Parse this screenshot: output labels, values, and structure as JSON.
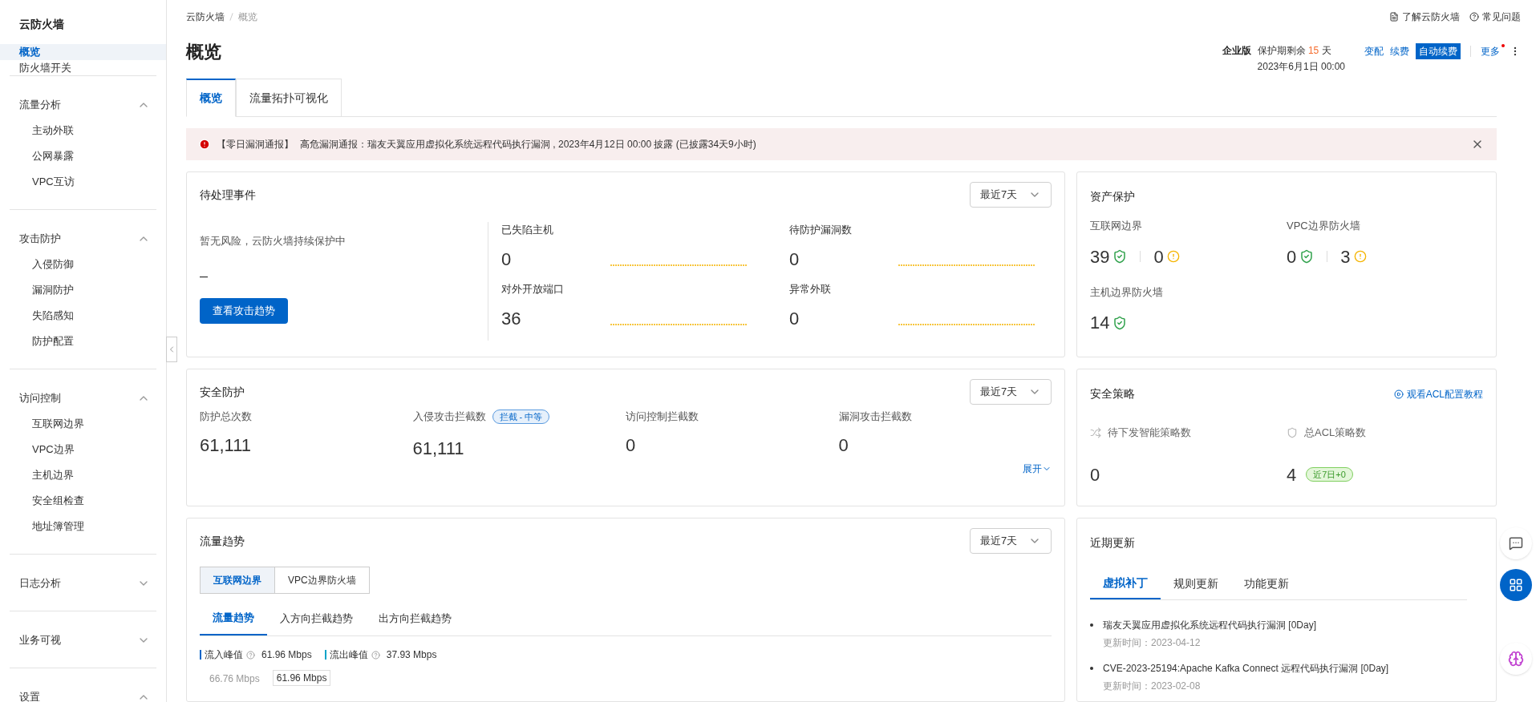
{
  "sidebar": {
    "title": "云防火墙",
    "top_items": [
      {
        "label": "概览",
        "selected": true
      },
      {
        "label": "防火墙开关",
        "selected": false
      }
    ],
    "groups": [
      {
        "label": "流量分析",
        "expanded": true,
        "children": [
          {
            "label": "主动外联"
          },
          {
            "label": "公网暴露"
          },
          {
            "label": "VPC互访"
          }
        ]
      },
      {
        "label": "攻击防护",
        "expanded": true,
        "children": [
          {
            "label": "入侵防御"
          },
          {
            "label": "漏洞防护"
          },
          {
            "label": "失陷感知"
          },
          {
            "label": "防护配置"
          }
        ]
      },
      {
        "label": "访问控制",
        "expanded": true,
        "children": [
          {
            "label": "互联网边界"
          },
          {
            "label": "VPC边界"
          },
          {
            "label": "主机边界"
          },
          {
            "label": "安全组检查"
          },
          {
            "label": "地址簿管理"
          }
        ]
      },
      {
        "label": "日志分析",
        "expanded": false
      },
      {
        "label": "业务可视",
        "expanded": false
      },
      {
        "label": "设置",
        "expanded": true
      }
    ]
  },
  "breadcrumb": [
    "云防火墙",
    "概览"
  ],
  "help_links": [
    {
      "label": "了解云防火墙",
      "kind": "doc"
    },
    {
      "label": "常见问题",
      "kind": "help"
    }
  ],
  "title": "概览",
  "subscription": {
    "edition": "企业版",
    "remaining_prefix": "保护期剩余",
    "days": "15",
    "days_suffix": "天",
    "expiry": "2023年6月1日 00:00",
    "actions": [
      {
        "label": "变配",
        "kind": "link"
      },
      {
        "label": "续费",
        "kind": "link"
      },
      {
        "label": "自动续费",
        "kind": "primary"
      }
    ],
    "more": {
      "label": "更多",
      "badge": true
    }
  },
  "tabs": [
    {
      "label": "概览",
      "selected": true
    },
    {
      "label": "流量拓扑可视化",
      "selected": false
    }
  ],
  "alert": {
    "title": "【零日漏洞通报】",
    "text": "高危漏洞通报：瑞友天翼应用虚拟化系统远程代码执行漏洞 , 2023年4月12日 00:00 披露 (已披露34天9小时)"
  },
  "pending": {
    "title": "待处理事件",
    "range": "最近7天",
    "status": "暂无风险，云防火墙持续保护中",
    "dash": "–",
    "button": "查看攻击趋势",
    "metrics": [
      {
        "label": "已失陷主机",
        "value": "0"
      },
      {
        "label": "待防护漏洞数",
        "value": "0"
      },
      {
        "label": "对外开放端口",
        "value": "36"
      },
      {
        "label": "异常外联",
        "value": "0"
      }
    ]
  },
  "assets": {
    "title": "资产保护",
    "groups": [
      {
        "label": "互联网边界",
        "ok": "39",
        "warn": "0"
      },
      {
        "label": "VPC边界防火墙",
        "ok": "0",
        "warn": "3"
      },
      {
        "label": "主机边界防火墙",
        "ok": "14"
      }
    ]
  },
  "security": {
    "title": "安全防护",
    "range": "最近7天",
    "expand": "展开",
    "stats": [
      {
        "label": "防护总次数",
        "value": "61,111"
      },
      {
        "label": "入侵攻击拦截数",
        "value": "61,111",
        "badge": "拦截 - 中等"
      },
      {
        "label": "访问控制拦截数",
        "value": "0"
      },
      {
        "label": "漏洞攻击拦截数",
        "value": "0"
      }
    ]
  },
  "policy": {
    "title": "安全策略",
    "link": "观看ACL配置教程",
    "stats": [
      {
        "label": "待下发智能策略数",
        "value": "0",
        "kind": "smart"
      },
      {
        "label": "总ACL策略数",
        "value": "4",
        "kind": "acl",
        "badge": "近7日+0"
      }
    ]
  },
  "traffic": {
    "title": "流量趋势",
    "range": "最近7天",
    "segments": [
      {
        "label": "互联网边界",
        "selected": true
      },
      {
        "label": "VPC边界防火墙",
        "selected": false
      }
    ],
    "tabs": [
      {
        "label": "流量趋势",
        "selected": true
      },
      {
        "label": "入方向拦截趋势",
        "selected": false
      },
      {
        "label": "出方向拦截趋势",
        "selected": false
      }
    ],
    "peaks": [
      {
        "label": "流入峰值",
        "value": "61.96 Mbps",
        "color": "#0064c8"
      },
      {
        "label": "流出峰值",
        "value": "37.93 Mbps",
        "color": "#00a3c8"
      }
    ],
    "axis_label": "66.76 Mbps",
    "tooltip": "61.96 Mbps"
  },
  "updates": {
    "title": "近期更新",
    "tabs": [
      {
        "label": "虚拟补丁",
        "selected": true
      },
      {
        "label": "规则更新",
        "selected": false
      },
      {
        "label": "功能更新",
        "selected": false
      }
    ],
    "items": [
      {
        "title": "瑞友天翼应用虚拟化系统远程代码执行漏洞 [0Day]",
        "time": "更新时间：2023-04-12"
      },
      {
        "title": "CVE-2023-25194:Apache Kafka Connect 远程代码执行漏洞 [0Day]",
        "time": "更新时间：2023-02-08"
      }
    ]
  }
}
